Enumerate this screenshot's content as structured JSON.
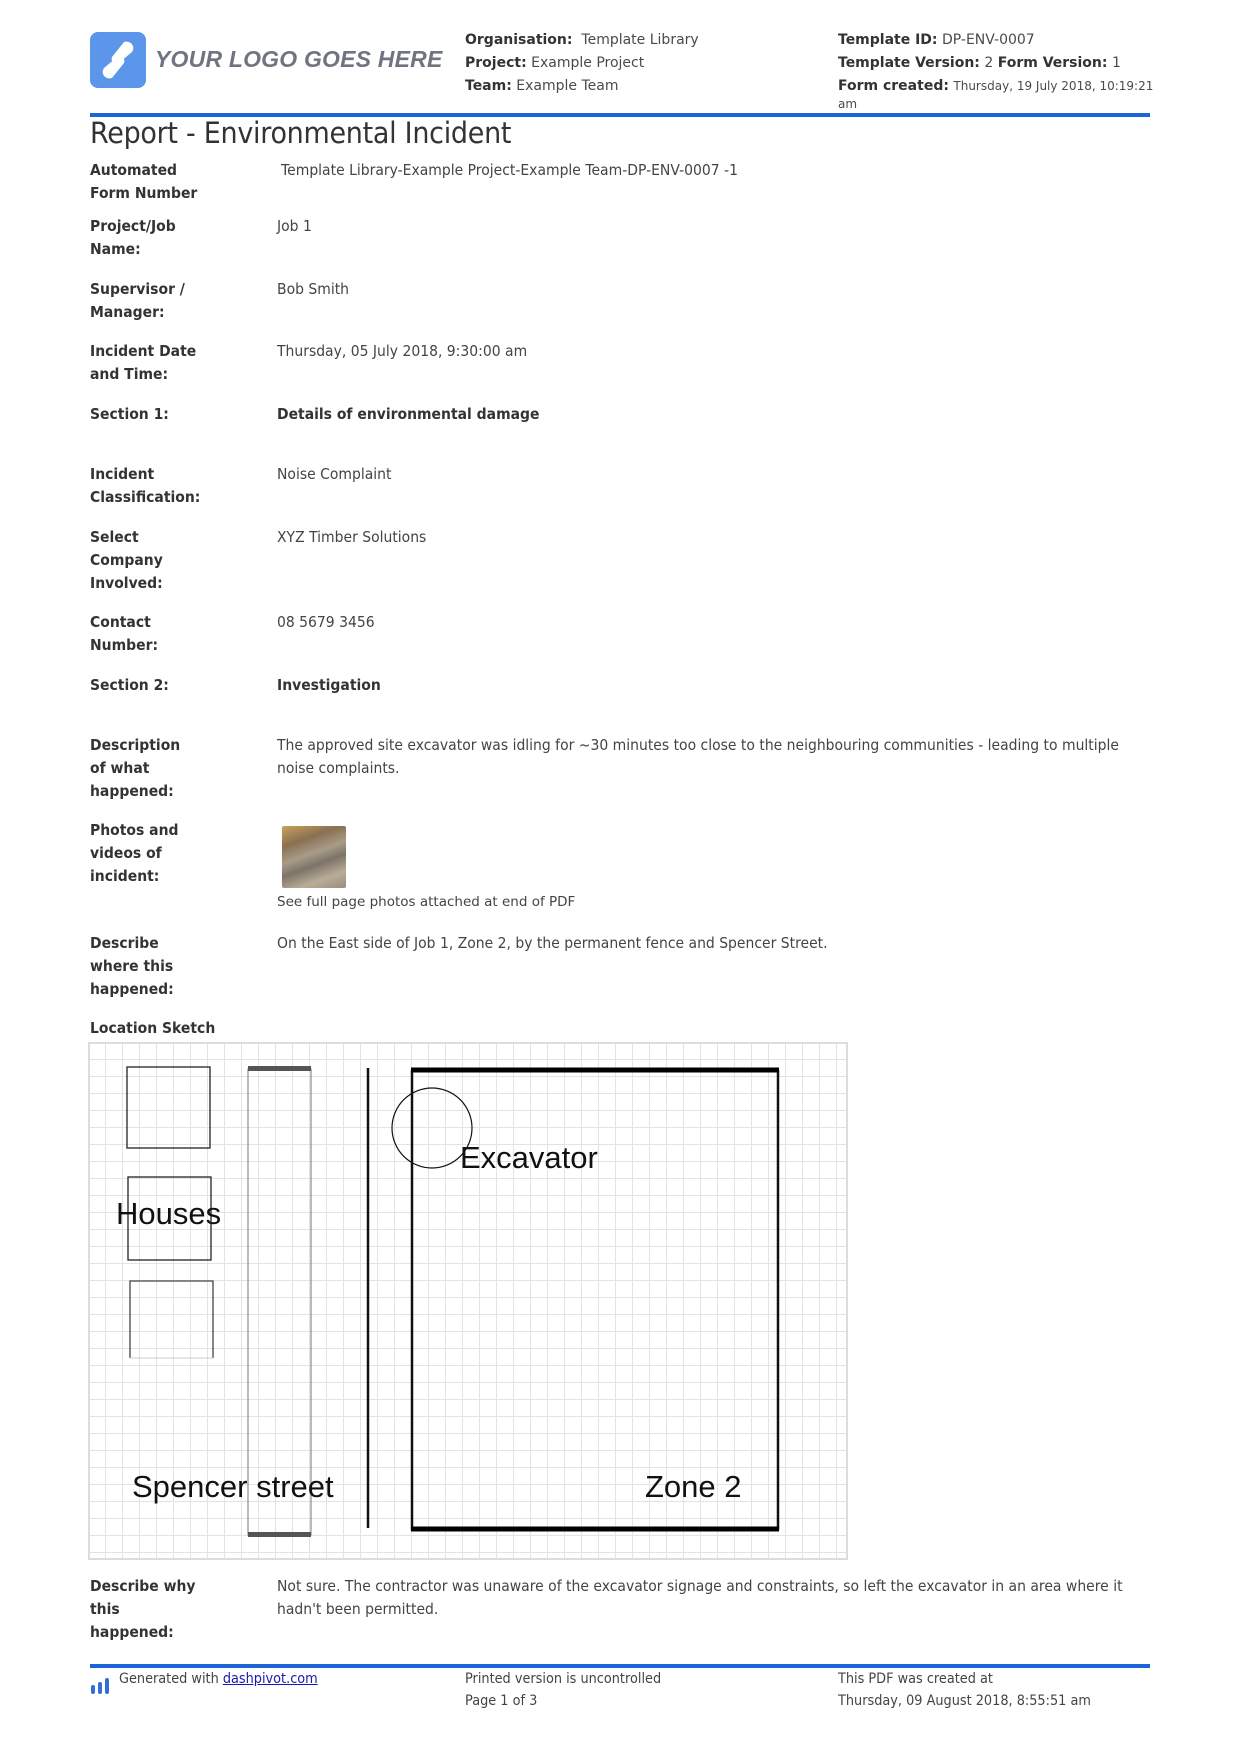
{
  "header": {
    "logo_text": "YOUR LOGO GOES HERE",
    "organisation_label": "Organisation:",
    "organisation_value": "Template Library",
    "project_label": "Project:",
    "project_value": "Example Project",
    "team_label": "Team:",
    "team_value": "Example Team",
    "template_id_label": "Template ID:",
    "template_id_value": "DP-ENV-0007",
    "template_version_label": "Template Version:",
    "template_version_value": "2",
    "form_version_label": "Form Version:",
    "form_version_value": "1",
    "form_created_label": "Form created:",
    "form_created_value": "Thursday, 19 July 2018, 10:19:21",
    "form_created_suffix": "am",
    "accent_color": "#1b63d6"
  },
  "report": {
    "title": "Report - Environmental Incident",
    "fields": [
      {
        "label": "Automated Form Number",
        "value": "Template Library-Example Project-Example Team-DP-ENV-0007   -1"
      },
      {
        "label": "Project/Job Name:",
        "value": "Job 1"
      },
      {
        "label": "Supervisor / Manager:",
        "value": "Bob Smith"
      },
      {
        "label": "Incident Date and Time:",
        "value": "Thursday, 05 July 2018, 9:30:00 am"
      },
      {
        "label": "Section 1:",
        "value": "Details of environmental damage"
      },
      {
        "label": "Incident Classification:",
        "value": "Noise Complaint"
      },
      {
        "label": "Select Company Involved:",
        "value": "XYZ Timber Solutions"
      },
      {
        "label": "Contact Number:",
        "value": "08 5679 3456"
      },
      {
        "label": "Section 2:",
        "value": "Investigation"
      },
      {
        "label": "Description of what happened:",
        "value": "The approved site excavator was idling for ~30 minutes too close to the neighbouring communities - leading to multiple noise complaints."
      },
      {
        "label": "Photos and videos of incident:",
        "value": "See full page photos attached at end of PDF"
      },
      {
        "label": "Describe where this happened:",
        "value": "On the East side of Job 1, Zone 2, by the permanent fence and Spencer Street."
      },
      {
        "label": "Describe why this happened:",
        "value": "Not sure. The contractor was unaware of the excavator signage and constraints, so left the excavator in an area where it hadn't been permitted."
      }
    ],
    "sketch": {
      "heading": "Location Sketch",
      "labels": {
        "houses": "Houses",
        "excavator": "Excavator",
        "street": "Spencer street",
        "zone": "Zone 2"
      }
    }
  },
  "footer": {
    "generated_prefix": "Generated with",
    "generated_link": "dashpivot.com",
    "uncontrolled": "Printed version is uncontrolled",
    "page": "Page 1 of 3",
    "pdf_created_label": "This PDF was created at",
    "pdf_created_value": "Thursday, 09 August 2018, 8:55:51 am"
  }
}
